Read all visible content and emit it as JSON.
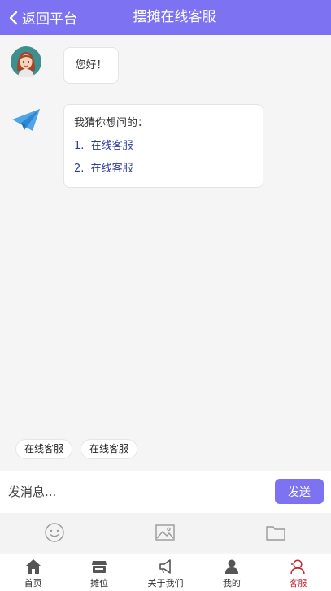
{
  "header": {
    "back_label": "返回平台",
    "title": "摆摊在线客服"
  },
  "chat": {
    "greeting": "您好！",
    "suggest_title": "我猜你想问的：",
    "suggestions": [
      {
        "num": "1.",
        "text": "在线客服"
      },
      {
        "num": "2.",
        "text": "在线客服"
      }
    ]
  },
  "quick_chips": [
    "在线客服",
    "在线客服"
  ],
  "input": {
    "placeholder": "发消息...",
    "send_label": "发送"
  },
  "tools": [
    "emoji-icon",
    "image-icon",
    "folder-icon"
  ],
  "tabbar": [
    {
      "label": "首页",
      "icon": "home-icon",
      "active": false
    },
    {
      "label": "摊位",
      "icon": "stall-icon",
      "active": false
    },
    {
      "label": "关于我们",
      "icon": "megaphone-icon",
      "active": false
    },
    {
      "label": "我的",
      "icon": "user-icon",
      "active": false
    },
    {
      "label": "客服",
      "icon": "service-icon",
      "active": true
    }
  ],
  "colors": {
    "accent": "#7c72f2",
    "active_tab": "#c4262d",
    "link": "#2a3a9e"
  }
}
